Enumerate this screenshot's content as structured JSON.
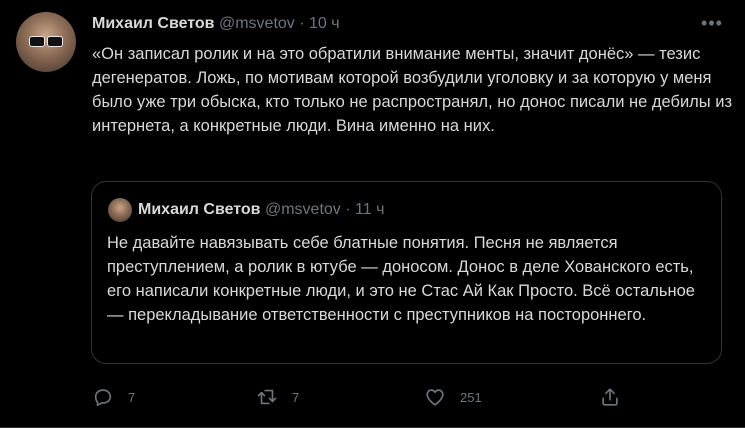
{
  "tweet": {
    "author_name": "Михаил Светов",
    "author_handle": "@msvetov",
    "separator": "·",
    "time": "10 ч",
    "more_label": "•••",
    "text": "«Он записал ролик и на это обратили внимание менты, значит донёс» — тезис дегенератов. Ложь, по мотивам которой возбудили уголовку и за которую у меня было уже три обыска, кто только не распространял, но донос писали не дебилы из интернета, а конкретные люди. Вина именно на них."
  },
  "quoted_tweet": {
    "author_name": "Михаил Светов",
    "author_handle": "@msvetov",
    "separator": "·",
    "time": "11 ч",
    "text": "Не давайте навязывать себе блатные понятия. Песня не является преступлением, а ролик в ютубе — доносом. Донос в деле Хованского есть, его написали конкретные люди, и это не Стас Ай Как Просто. Всё остальное — перекладывание ответственности с преступников на постороннего."
  },
  "actions": {
    "reply_count": "7",
    "retweet_count": "7",
    "like_count": "251"
  },
  "icons": {
    "reply": "reply-icon",
    "retweet": "retweet-icon",
    "like": "like-icon",
    "share": "share-icon",
    "more": "more-icon"
  },
  "colors": {
    "background": "#000000",
    "text": "#d9d9d9",
    "secondary": "#6e767d",
    "border": "#2f3336"
  }
}
